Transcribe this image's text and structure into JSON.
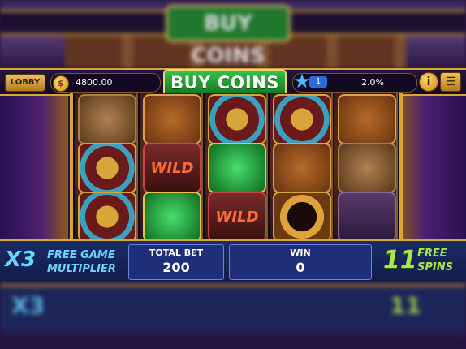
{
  "topbar": {
    "lobby_label": "LOBBY",
    "coins": "4800.00",
    "buy_label": "BUY COINS",
    "level": "1",
    "level_progress": "2.0%",
    "info_icon": "info-icon",
    "menu_icon": "menu-icon"
  },
  "reels": [
    [
      "sym-bag",
      "sym-wheel",
      "sym-wheel"
    ],
    [
      "sym-mask",
      "sym-wild",
      "sym-emerald"
    ],
    [
      "sym-wheel",
      "sym-emerald",
      "sym-wild"
    ],
    [
      "sym-wheel",
      "sym-mask",
      "sym-ring"
    ],
    [
      "sym-mask",
      "sym-bag",
      "sym-snake"
    ]
  ],
  "bottombar": {
    "multiplier_value": "X3",
    "multiplier_line1": "FREE GAME",
    "multiplier_line2": "MULTIPLIER",
    "total_bet_label": "TOTAL BET",
    "total_bet_value": "200",
    "win_label": "WIN",
    "win_value": "0",
    "free_spins_value": "11",
    "free_spins_line1": "FREE",
    "free_spins_line2": "SPINS"
  },
  "colors": {
    "gold_trim": "#d8a53a",
    "buy_green": "#36c24a",
    "multiplier_blue": "#6ad6ff",
    "free_spins_green": "#a6e84a"
  }
}
